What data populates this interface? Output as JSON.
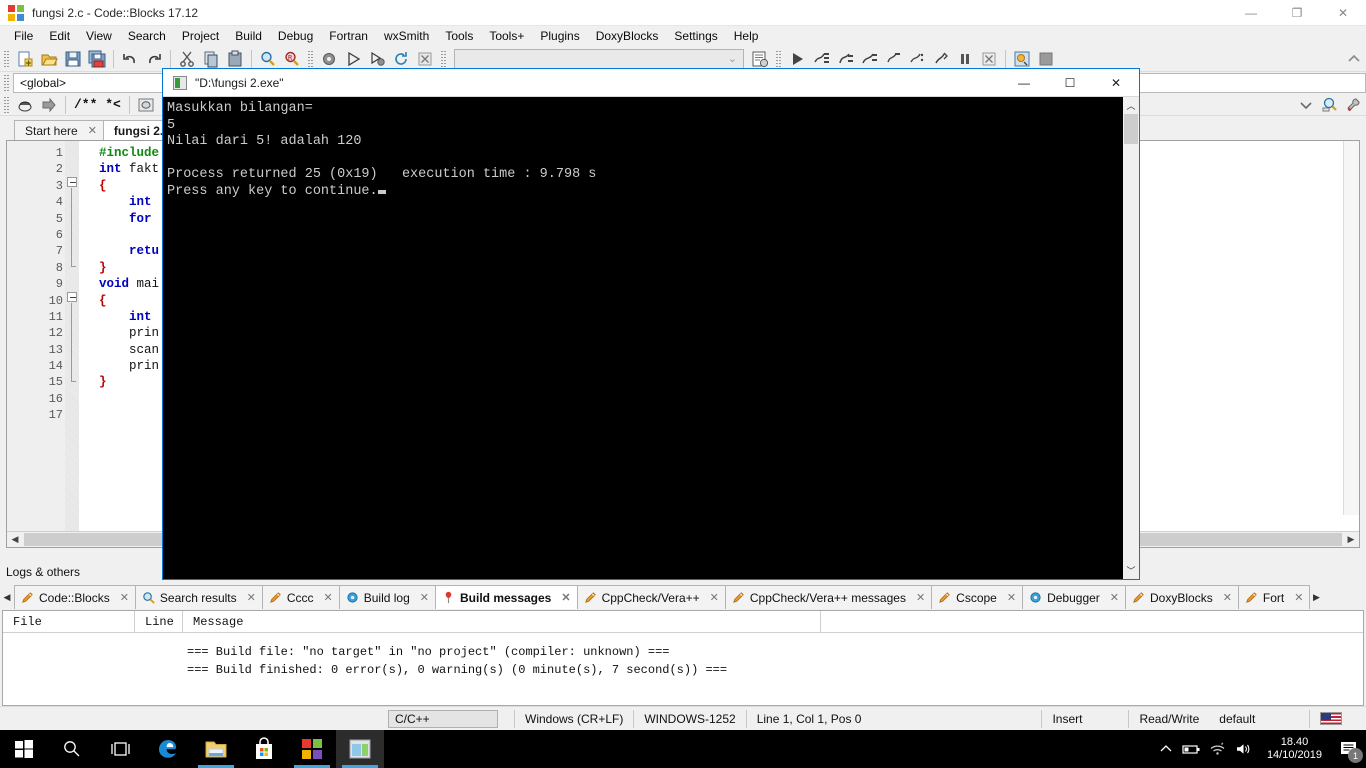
{
  "window": {
    "title": "fungsi 2.c - Code::Blocks 17.12",
    "icon": "codeblocks-icon",
    "minimize": "—",
    "restore": "❐",
    "close": "✕"
  },
  "menubar": {
    "items": [
      "File",
      "Edit",
      "View",
      "Search",
      "Project",
      "Build",
      "Debug",
      "Fortran",
      "wxSmith",
      "Tools",
      "Tools+",
      "Plugins",
      "DoxyBlocks",
      "Settings",
      "Help"
    ]
  },
  "toolbar": {
    "icons": [
      "new-file-icon",
      "open-file-icon",
      "save-icon",
      "save-all-icon",
      "undo-icon",
      "redo-icon",
      "cut-icon",
      "copy-icon",
      "paste-icon",
      "find-icon",
      "replace-icon",
      "build-icon",
      "run-icon",
      "build-and-run-icon",
      "rebuild-icon",
      "abort-icon"
    ],
    "build_target_value": "",
    "target_dropdown_icon": "chevron-down-icon",
    "select_target_icon": "select-target-icon",
    "debug_icons": [
      "debug-continue-icon",
      "debug-run-to-cursor-icon",
      "debug-next-line-icon",
      "debug-step-into-icon",
      "debug-step-out-icon",
      "debug-next-instruction-icon",
      "debug-step-into-instruction-icon",
      "debug-break-icon",
      "debug-stop-icon",
      "debugging-windows-icon",
      "various-info-icon"
    ],
    "right_icons": [
      "up-icon",
      "chevron-down-icon",
      "doxyblocks-search-icon",
      "doxyblocks-config-icon"
    ]
  },
  "toolbar2": {
    "icons": [
      "doxyblocks-run-icon",
      "doxyblocks-extract-icon"
    ],
    "doc_block_label": "/** *<",
    "more_icons": [
      "doxyblocks-comment-icon",
      "doxyblocks-help-icon"
    ]
  },
  "scope": {
    "value": "<global>",
    "caret_icon": "chevron-down-icon"
  },
  "editor_tabs": [
    {
      "label": "Start here",
      "active": false,
      "close": "✕"
    },
    {
      "label": "fungsi 2.c",
      "active": true,
      "close": "✕"
    }
  ],
  "editor": {
    "line_numbers": [
      "1",
      "2",
      "3",
      "4",
      "5",
      "6",
      "7",
      "8",
      "9",
      "10",
      "11",
      "12",
      "13",
      "14",
      "15",
      "16",
      "17"
    ],
    "lines": [
      {
        "n": 1,
        "tokens": [
          {
            "t": "#include",
            "c": "pp"
          }
        ]
      },
      {
        "n": 2,
        "tokens": [
          {
            "t": "int",
            "c": "kw"
          },
          {
            "t": " fakt",
            "c": "id"
          }
        ]
      },
      {
        "n": 3,
        "tokens": [
          {
            "t": "{",
            "c": "br"
          }
        ]
      },
      {
        "n": 4,
        "tokens": [
          {
            "t": "    ",
            "c": "id"
          },
          {
            "t": "int",
            "c": "kw"
          }
        ]
      },
      {
        "n": 5,
        "tokens": [
          {
            "t": "    ",
            "c": "id"
          },
          {
            "t": "for",
            "c": "kw"
          }
        ]
      },
      {
        "n": 6,
        "tokens": []
      },
      {
        "n": 7,
        "tokens": [
          {
            "t": "    ",
            "c": "id"
          },
          {
            "t": "retu",
            "c": "kw"
          }
        ]
      },
      {
        "n": 8,
        "tokens": [
          {
            "t": "}",
            "c": "br"
          }
        ]
      },
      {
        "n": 9,
        "tokens": [
          {
            "t": "void",
            "c": "kw"
          },
          {
            "t": " mai",
            "c": "id"
          }
        ]
      },
      {
        "n": 10,
        "tokens": [
          {
            "t": "{",
            "c": "br"
          }
        ]
      },
      {
        "n": 11,
        "tokens": [
          {
            "t": "    ",
            "c": "id"
          },
          {
            "t": "int",
            "c": "kw"
          }
        ]
      },
      {
        "n": 12,
        "tokens": [
          {
            "t": "    prin",
            "c": "id"
          }
        ]
      },
      {
        "n": 13,
        "tokens": [
          {
            "t": "    scan",
            "c": "id"
          }
        ]
      },
      {
        "n": 14,
        "tokens": [
          {
            "t": "    prin",
            "c": "id"
          }
        ]
      },
      {
        "n": 15,
        "tokens": [
          {
            "t": "}",
            "c": "br"
          }
        ]
      },
      {
        "n": 16,
        "tokens": []
      },
      {
        "n": 17,
        "tokens": []
      }
    ],
    "hscroll_left_icon": "chevron-left-icon",
    "hscroll_right_icon": "chevron-right-icon"
  },
  "console": {
    "title": "\"D:\\fungsi 2.exe\"",
    "icon": "console-icon",
    "minimize": "—",
    "maximize": "☐",
    "close": "✕",
    "output": "Masukkan bilangan=\n5\nNilai dari 5! adalah 120\n\nProcess returned 25 (0x19)   execution time : 9.798 s\nPress any key to continue.",
    "scroll_up_icon": "chevron-up-icon",
    "scroll_down_icon": "chevron-down-icon"
  },
  "logs": {
    "panel_title": "Logs & others",
    "scroll_left_icon": "chevron-left-icon",
    "scroll_right_icon": "chevron-right-icon",
    "tabs": [
      {
        "label": "Code::Blocks",
        "icon": "pencil-icon",
        "active": false,
        "close": "✕"
      },
      {
        "label": "Search results",
        "icon": "magnifier-icon",
        "active": false,
        "close": "✕"
      },
      {
        "label": "Cccc",
        "icon": "pencil-icon",
        "active": false,
        "close": "✕"
      },
      {
        "label": "Build log",
        "icon": "gear-blue-icon",
        "active": false,
        "close": "✕"
      },
      {
        "label": "Build messages",
        "icon": "pin-red-icon",
        "active": true,
        "close": "✕"
      },
      {
        "label": "CppCheck/Vera++",
        "icon": "pencil-icon",
        "active": false,
        "close": "✕"
      },
      {
        "label": "CppCheck/Vera++ messages",
        "icon": "pencil-icon",
        "active": false,
        "close": "✕"
      },
      {
        "label": "Cscope",
        "icon": "pencil-icon",
        "active": false,
        "close": "✕"
      },
      {
        "label": "Debugger",
        "icon": "gear-blue-icon",
        "active": false,
        "close": "✕"
      },
      {
        "label": "DoxyBlocks",
        "icon": "pencil-icon",
        "active": false,
        "close": "✕"
      },
      {
        "label": "Fort",
        "icon": "pencil-icon",
        "active": false,
        "close": "✕"
      }
    ],
    "columns": [
      "File",
      "Line",
      "Message"
    ],
    "rows": [
      {
        "file": "",
        "line": "",
        "message": "=== Build file: \"no target\" in \"no project\" (compiler: unknown) ==="
      },
      {
        "file": "",
        "line": "",
        "message": "=== Build finished: 0 error(s), 0 warning(s) (0 minute(s), 7 second(s)) ==="
      }
    ]
  },
  "statusbar": {
    "language": "C/C++",
    "eol": "Windows (CR+LF)",
    "encoding": "WINDOWS-1252",
    "caret": "Line 1, Col 1, Pos 0",
    "mode": "Insert",
    "access": "Read/Write",
    "profile": "default",
    "keyboard_flag": "us-flag-icon"
  },
  "taskbar": {
    "buttons": [
      {
        "name": "start-button",
        "icon": "windows-logo-icon",
        "active": false,
        "underline": false
      },
      {
        "name": "search-button",
        "icon": "search-icon",
        "active": false,
        "underline": false
      },
      {
        "name": "task-view-button",
        "icon": "task-view-icon",
        "active": false,
        "underline": false
      },
      {
        "name": "edge-button",
        "icon": "edge-icon",
        "active": false,
        "underline": false
      },
      {
        "name": "file-explorer-button",
        "icon": "folder-icon",
        "active": false,
        "underline": true
      },
      {
        "name": "store-button",
        "icon": "store-icon",
        "active": false,
        "underline": false
      },
      {
        "name": "ms-office-button",
        "icon": "ms-squares-icon",
        "active": false,
        "underline": true
      },
      {
        "name": "codeblocks-taskbar-button",
        "icon": "codeblocks-window-icon",
        "active": true,
        "underline": true
      }
    ],
    "tray": {
      "show_hidden_icon": "chevron-up-icon",
      "battery_icon": "battery-icon",
      "wifi_icon": "wifi-icon",
      "volume_icon": "speaker-icon",
      "time": "18.40",
      "date": "14/10/2019",
      "action_center_icon": "action-center-icon",
      "notification_count": "1"
    }
  },
  "colors": {
    "accent_blue": "#0078d7",
    "console_bg": "#000000",
    "console_text": "#cccccc",
    "chrome_bg": "#f0f0f0",
    "keyword_blue": "#0000c0",
    "preproc_green": "#0f8a0f",
    "brace_red": "#c00000"
  }
}
